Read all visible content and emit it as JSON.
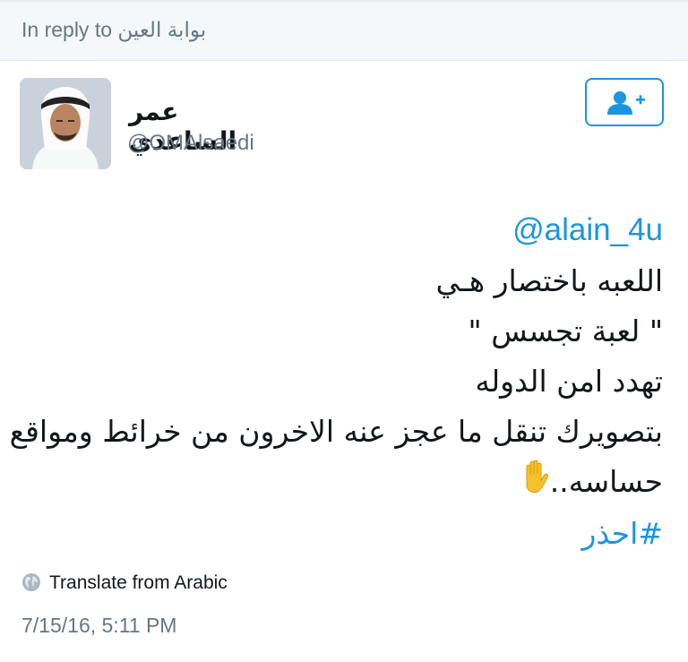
{
  "reply": {
    "prefix": "In reply to",
    "name": "بوابة العين"
  },
  "user": {
    "display_name": "عمر الساعدي",
    "handle": "@OMAlsaedi"
  },
  "follow_button": {
    "icon": "follow-user-icon"
  },
  "tweet": {
    "mention": "@alain_4u",
    "lines": [
      "اللعبه باختصار هـي",
      "\" لعبة تجسس \"",
      "تهدد امن الدوله",
      "بتصويرك تنقل ما عجز عنه الاخرون من خرائط ومواقع",
      "حساسه.."
    ],
    "emoji": "raised-hand-icon",
    "hashtag": "#احذر"
  },
  "translate": {
    "icon": "globe-icon",
    "label": "Translate from Arabic"
  },
  "timestamp": "7/15/16, 5:11 PM",
  "colors": {
    "link": "#1b95e0",
    "muted": "#657786",
    "text": "#14171a",
    "reply_bar_bg": "#f5f8fa"
  }
}
